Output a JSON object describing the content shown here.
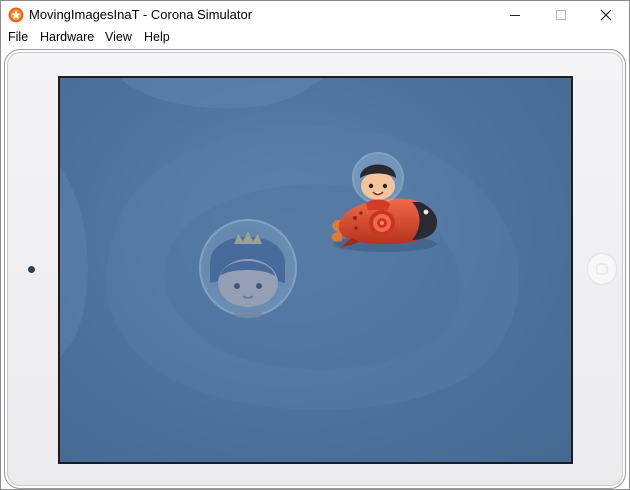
{
  "window": {
    "title": "MovingImagesInaT - Corona Simulator",
    "icon": "corona-app-icon",
    "controls": [
      "minimize-icon",
      "maximize-icon",
      "close-icon"
    ]
  },
  "menu": {
    "items": [
      "File",
      "Hardware",
      "View",
      "Help"
    ]
  },
  "device": {
    "type": "tablet-frame",
    "screen": {
      "background_color": "#4f739d",
      "sprites": [
        "astronaut-on-rocket-sprite",
        "princess-bubble-sprite"
      ]
    }
  }
}
